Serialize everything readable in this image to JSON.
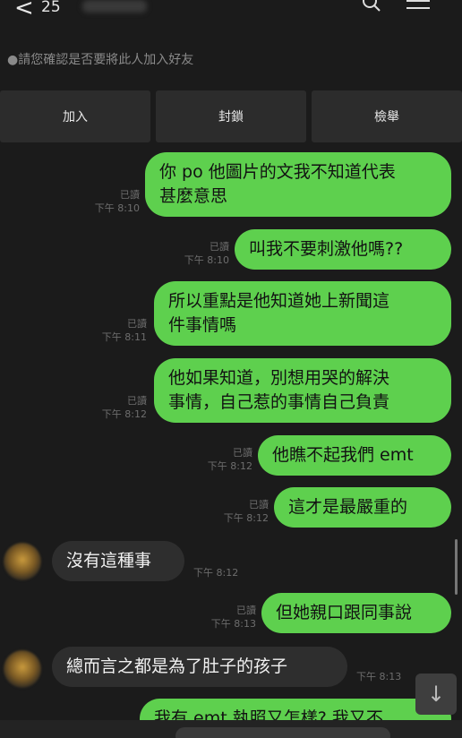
{
  "header": {
    "back_glyph": "<",
    "count": "25",
    "search_icon": "search-icon",
    "menu_icon": "menu-icon"
  },
  "notice": "●請您確認是否要將此人加入好友",
  "actions": {
    "add": "加入",
    "block": "封鎖",
    "report": "檢舉"
  },
  "colors": {
    "background": "#1b1b1b",
    "outgoing_bubble": "#5ed04e",
    "incoming_bubble": "#2e2e2e"
  },
  "messages": [
    {
      "dir": "out",
      "lines": [
        "你 po 他圖片的文我不知道代表",
        "甚麼意思"
      ],
      "read": "已讀",
      "time": "下午 8:10"
    },
    {
      "dir": "out",
      "lines": [
        "叫我不要刺激他嗎??"
      ],
      "read": "已讀",
      "time": "下午 8:10"
    },
    {
      "dir": "out",
      "lines": [
        "所以重點是他知道她上新聞這",
        "件事情嗎"
      ],
      "read": "已讀",
      "time": "下午 8:11"
    },
    {
      "dir": "out",
      "lines": [
        "他如果知道，別想用哭的解決",
        "事情，自己惹的事情自己負責"
      ],
      "read": "已讀",
      "time": "下午 8:12"
    },
    {
      "dir": "out",
      "lines": [
        "他瞧不起我們 emt"
      ],
      "read": "已讀",
      "time": "下午 8:12"
    },
    {
      "dir": "out",
      "lines": [
        "這才是最嚴重的"
      ],
      "read": "已讀",
      "time": "下午 8:12"
    },
    {
      "dir": "in",
      "lines": [
        "沒有這種事"
      ],
      "time": "下午 8:12"
    },
    {
      "dir": "out",
      "lines": [
        "但她親口跟同事說"
      ],
      "read": "已讀",
      "time": "下午 8:13"
    },
    {
      "dir": "in",
      "lines": [
        "總而言之都是為了肚子的孩子"
      ],
      "time": "下午 8:13"
    },
    {
      "dir": "out",
      "lines": [
        "我有 emt 執照又怎樣? 我又不"
      ],
      "read": "",
      "time": ""
    }
  ],
  "scroll_down_glyph": "↓"
}
